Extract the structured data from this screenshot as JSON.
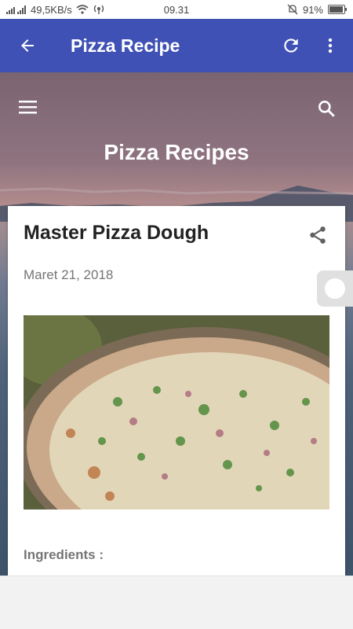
{
  "status_bar": {
    "network_speed": "49,5KB/s",
    "time": "09.31",
    "battery": "91%"
  },
  "app_bar": {
    "title": "Pizza Recipe"
  },
  "blog": {
    "title": "Pizza Recipes"
  },
  "post": {
    "title": "Master Pizza Dough",
    "date": "Maret 21, 2018",
    "section_heading": "Ingredients :"
  },
  "icons": {
    "back": "arrow-back-icon",
    "refresh": "refresh-icon",
    "more": "more-vert-icon",
    "menu": "hamburger-menu-icon",
    "search": "search-icon",
    "share": "share-icon"
  },
  "colors": {
    "app_bar": "#3f51b5",
    "card": "#ffffff",
    "muted_text": "#757575"
  }
}
